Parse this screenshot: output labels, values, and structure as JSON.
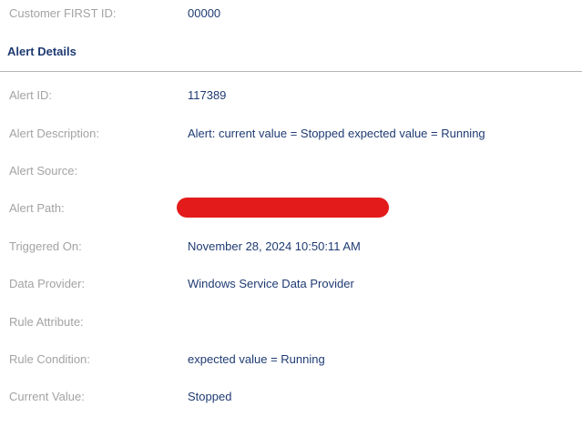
{
  "customer": {
    "label": "Customer FIRST ID:",
    "value": "00000"
  },
  "section": {
    "title": "Alert Details"
  },
  "fields": {
    "alert_id": {
      "label": "Alert ID:",
      "value": "117389"
    },
    "alert_description": {
      "label": "Alert Description:",
      "value": "Alert: current value = Stopped expected value = Running"
    },
    "alert_source": {
      "label": "Alert Source:",
      "value": ""
    },
    "alert_path": {
      "label": "Alert Path:",
      "value": ""
    },
    "triggered_on": {
      "label": "Triggered On:",
      "value": "November 28, 2024 10:50:11 AM"
    },
    "data_provider": {
      "label": "Data Provider:",
      "value": "Windows Service Data Provider"
    },
    "rule_attribute": {
      "label": "Rule Attribute:",
      "value": ""
    },
    "rule_condition": {
      "label": "Rule Condition:",
      "value": "expected value = Running"
    },
    "current_value": {
      "label": "Current Value:",
      "value": "Stopped"
    }
  },
  "colors": {
    "label": "#a3a3a3",
    "value": "#1f3b73",
    "redaction": "#e31b1b",
    "divider": "#b5b5b5"
  }
}
